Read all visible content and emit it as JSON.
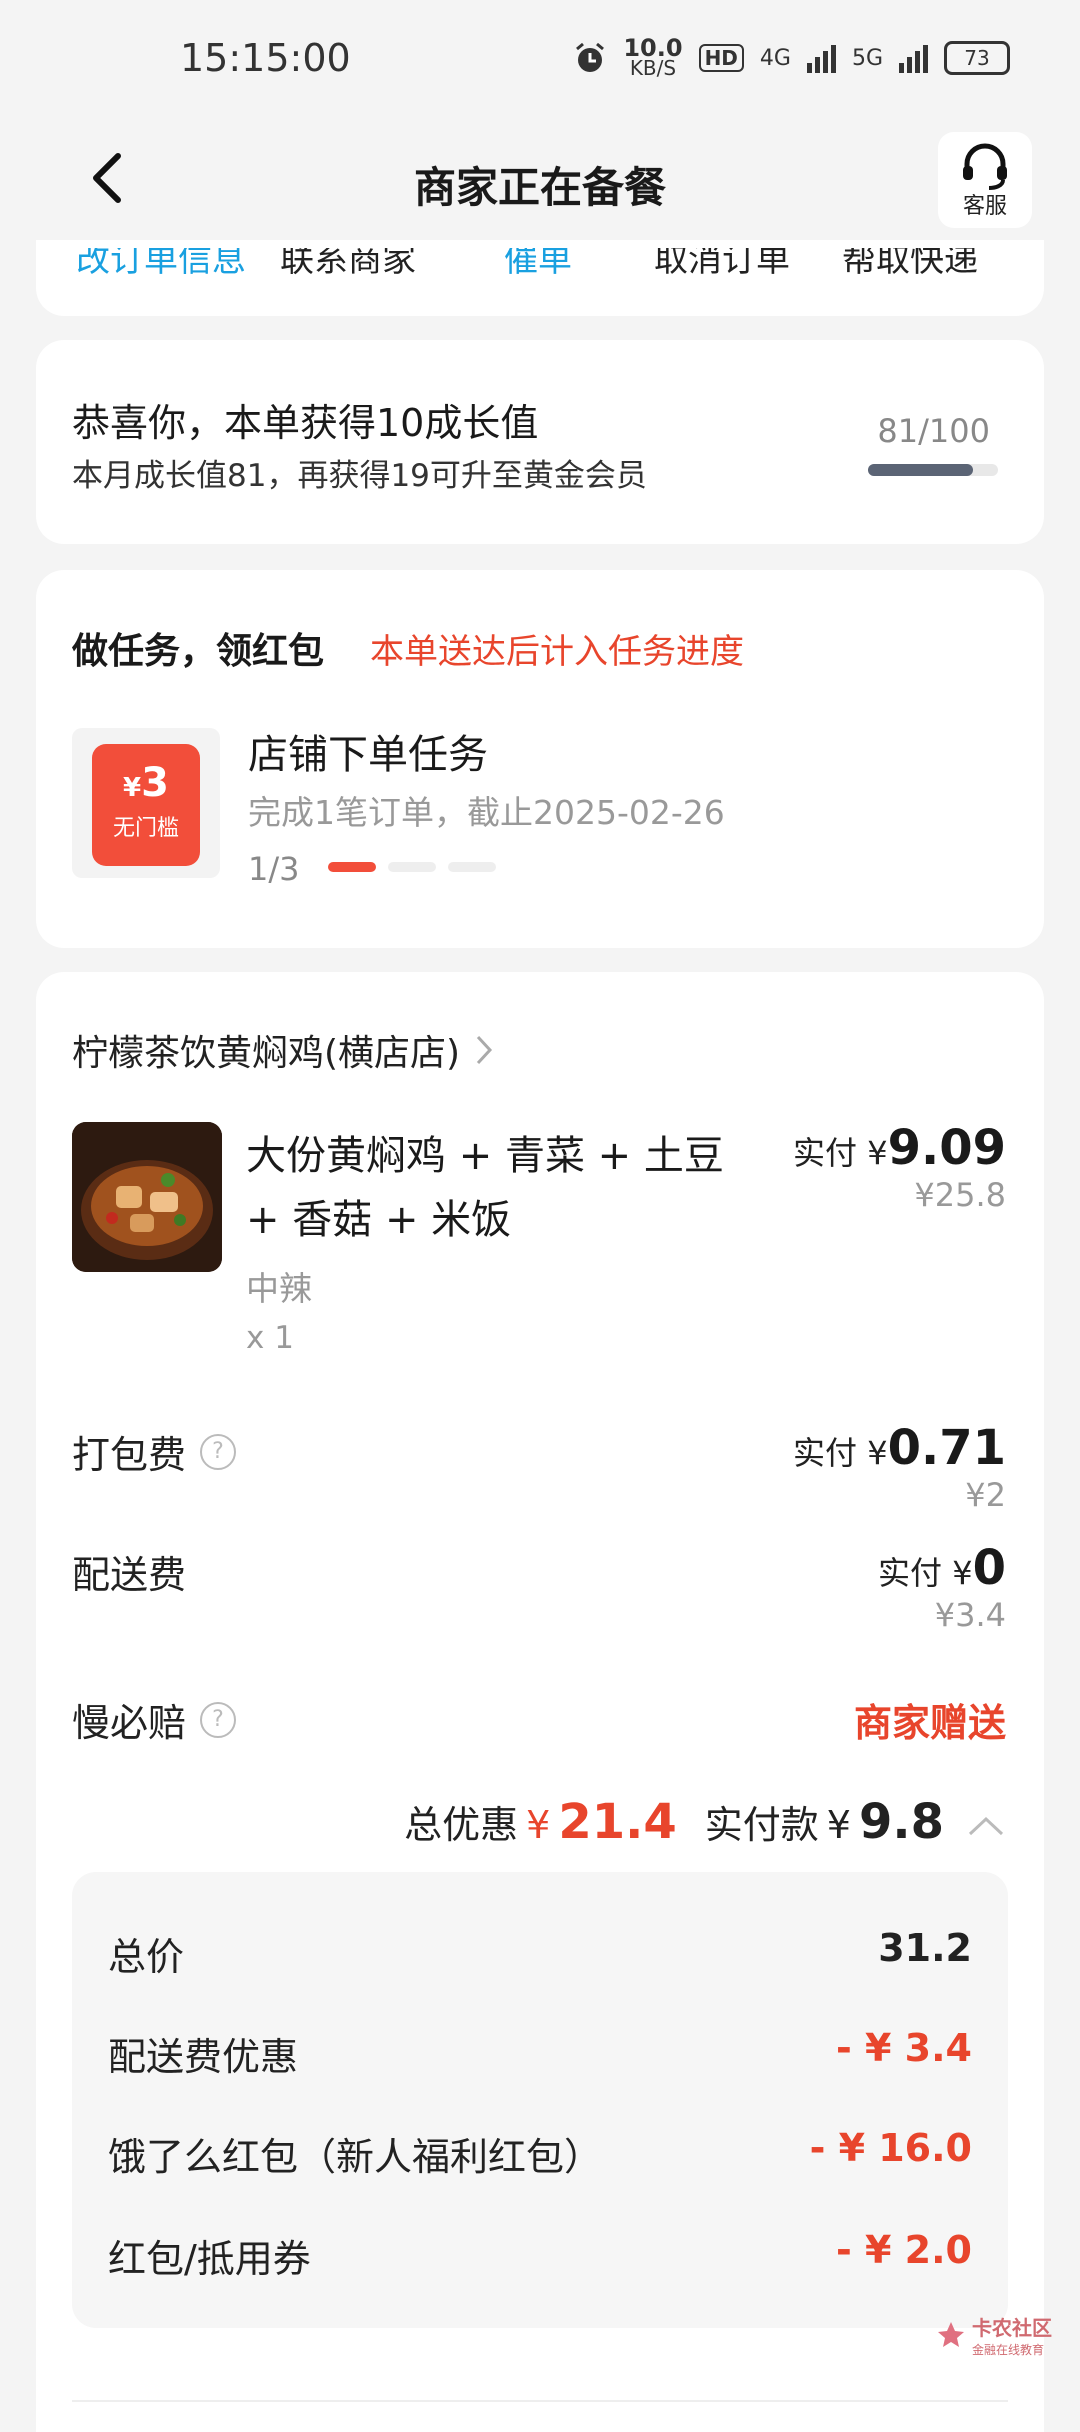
{
  "status": {
    "time": "15:15:00",
    "speed_value": "10.0",
    "speed_unit": "KB/S",
    "hd": "HD",
    "net1": "4G",
    "net2": "5G",
    "battery": "73"
  },
  "nav": {
    "title": "商家正在备餐",
    "customer_service": "客服"
  },
  "actions": {
    "items": [
      "改订单信息",
      "联系商家",
      "催单",
      "取消订单",
      "帮取快递"
    ]
  },
  "growth": {
    "title": "恭喜你，本单获得10成长值",
    "subtitle": "本月成长值81，再获得19可升至黄金会员",
    "progress_text": "81/100",
    "progress_fraction": 0.81
  },
  "task": {
    "heading": "做任务，领红包",
    "hint": "本单送达后计入任务进度",
    "coupon_symbol": "¥",
    "coupon_value": "3",
    "coupon_tag": "无门槛",
    "name": "店铺下单任务",
    "desc": "完成1笔订单，截止2025-02-26",
    "progress": "1/3"
  },
  "order": {
    "shop": "柠檬茶饮黄焖鸡(横店店)",
    "item_name": "大份黄焖鸡 + 青菜 + 土豆 + 香菇 + 米饭",
    "item_spec": "中辣",
    "item_qty": "x 1",
    "item_paid_label": "实付 ¥",
    "item_paid": "9.09",
    "item_orig": "¥25.8",
    "pack_label": "打包费",
    "pack_paid_label": "实付 ¥",
    "pack_paid": "0.71",
    "pack_orig": "¥2",
    "delivery_label": "配送费",
    "delivery_paid_label": "实付 ¥",
    "delivery_paid": "0",
    "delivery_orig": "¥3.4",
    "slow_label": "慢必赔",
    "slow_value": "商家赠送",
    "discount_label": "总优惠",
    "discount_symbol": "¥",
    "discount_value": "21.4",
    "actual_label": "实付款",
    "actual_symbol": "¥",
    "actual_value": "9.8"
  },
  "breakdown": [
    {
      "label": "总价",
      "value": "31.2"
    },
    {
      "label": "配送费优惠",
      "value": "- ¥ 3.4"
    },
    {
      "label": "饿了么红包（新人福利红包）",
      "value": "- ¥ 16.0"
    },
    {
      "label": "红包/抵用券",
      "value": "- ¥ 2.0"
    }
  ],
  "watermark": {
    "title": "卡农社区",
    "sub": "金融在线教育"
  },
  "colors": {
    "accent_red": "#e8452c",
    "link_blue": "#19a0e0",
    "background": "#f4f4f4"
  }
}
